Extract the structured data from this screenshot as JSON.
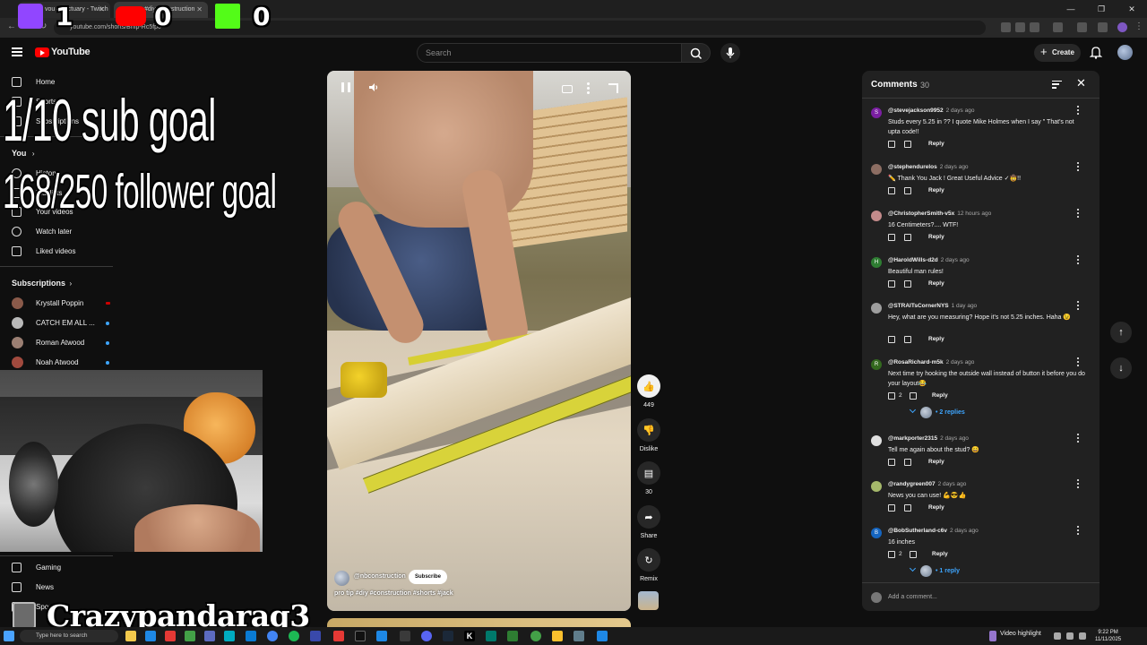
{
  "browser": {
    "tabs": [
      {
        "label": "vou Sanctuary - Twitch"
      },
      {
        "label": "#diy #construction"
      }
    ],
    "url": "youtube.com/shorts/BnIp-Rc5fp0"
  },
  "stream_overlay": {
    "twitch_count": "1",
    "youtube_count": "0",
    "kick_count": "0",
    "sub_goal": "1/10 sub goal",
    "follower_goal": "168/250 follower goal",
    "streamer_name": "Crazypandarag3",
    "colors": {
      "twitch": "#9146ff",
      "youtube": "#ff0000",
      "kick": "#53fc18"
    }
  },
  "header": {
    "logo_text": "YouTube",
    "search_placeholder": "Search",
    "create_label": "Create"
  },
  "sidebar": {
    "top_items": [
      {
        "label": "Home",
        "icon": "home-icon"
      },
      {
        "label": "Shorts",
        "icon": "shorts-icon"
      },
      {
        "label": "Subscriptions",
        "icon": "subscriptions-icon"
      }
    ],
    "you_heading": "You",
    "you_items": [
      {
        "label": "History",
        "icon": "history-icon"
      },
      {
        "label": "Playlists",
        "icon": "playlist-icon"
      },
      {
        "label": "Your videos",
        "icon": "video-icon"
      },
      {
        "label": "Watch later",
        "icon": "clock-icon"
      },
      {
        "label": "Liked videos",
        "icon": "thumbs-up-icon"
      }
    ],
    "subscriptions_heading": "Subscriptions",
    "subscriptions": [
      {
        "label": "Krystall Poppin",
        "status": "live"
      },
      {
        "label": "CATCH EM ALL ...",
        "status": "new"
      },
      {
        "label": "Roman Atwood",
        "status": "new"
      },
      {
        "label": "Noah Atwood",
        "status": "new"
      }
    ],
    "explore_items": [
      {
        "label": "Gaming",
        "icon": "gaming-icon"
      },
      {
        "label": "News",
        "icon": "news-icon"
      },
      {
        "label": "Sports",
        "icon": "sports-icon"
      }
    ]
  },
  "short": {
    "channel": "@nbconstruction",
    "subscribe_label": "Subscribe",
    "caption": "pro tip #diy #construction #shorts #jack",
    "like_count": "449",
    "dislike_label": "Dislike",
    "comment_count": "30",
    "share_label": "Share",
    "remix_label": "Remix"
  },
  "comments_panel": {
    "title": "Comments",
    "count": "30",
    "reply_label": "Reply",
    "add_placeholder": "Add a comment...",
    "comments": [
      {
        "user": "@stevejackson9952",
        "time": "2 days ago",
        "text": "Studs every 5.25 in ?? I quote Mike Holmes when I say \" That's not upta code!!",
        "likes": "",
        "avatar_letter": "S",
        "avatar_color": "#7b1fa2"
      },
      {
        "user": "@stephendurelos",
        "time": "2 days ago",
        "text": "✏️ Thank You Jack ! Great Useful Advice ✓🤠!!",
        "likes": "",
        "avatar_letter": "",
        "avatar_color": "#8d6e63"
      },
      {
        "user": "@ChristopherSmith-v5x",
        "time": "12 hours ago",
        "text": "16 Centimeters?.... WTF!",
        "likes": "",
        "avatar_letter": "",
        "avatar_color": "#c48b8b"
      },
      {
        "user": "@HaroldWills-d2d",
        "time": "2 days ago",
        "text": "Beautiful man rules!",
        "likes": "",
        "avatar_letter": "H",
        "avatar_color": "#2e7d32"
      },
      {
        "user": "@STRAITsCornerNYS",
        "time": "1 day ago",
        "text": "Hey, what are you measuring? Hope it's not 5.25 inches. Haha 😉",
        "likes": "",
        "avatar_letter": "",
        "avatar_color": "#9e9e9e"
      },
      {
        "user": "@RosaRichard-m5k",
        "time": "2 days ago",
        "text": "Next time try hooking the outside wall instead of button it before you do your layout😂",
        "likes": "2",
        "avatar_letter": "R",
        "avatar_color": "#33691e",
        "replies": "2 replies"
      },
      {
        "user": "@markporter2315",
        "time": "2 days ago",
        "text": "Tell me again about the stud? 😄",
        "likes": "",
        "avatar_letter": "",
        "avatar_color": "#e0e0e0"
      },
      {
        "user": "@randygreen007",
        "time": "2 days ago",
        "text": "News you can use! 💪😎👍",
        "likes": "",
        "avatar_letter": "",
        "avatar_color": "#a5b86b"
      },
      {
        "user": "@BobSutherland-c6v",
        "time": "2 days ago",
        "text": "16 inches",
        "likes": "2",
        "avatar_letter": "B",
        "avatar_color": "#1565c0",
        "replies": "1 reply"
      }
    ]
  },
  "taskbar": {
    "search_placeholder": "Type here to search",
    "widget": "Video highlight",
    "time": "9:22 PM",
    "date": "11/11/2025"
  }
}
